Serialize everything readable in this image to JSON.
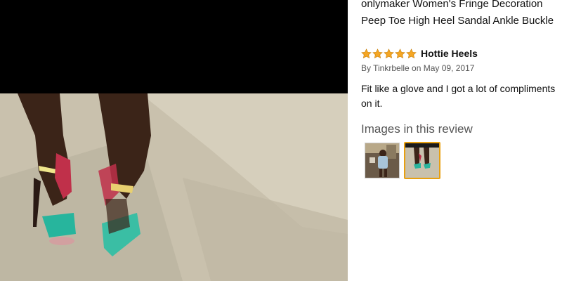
{
  "product": {
    "title": "onlymaker Women's Fringe Decoration Peep Toe High Heel Sandal Ankle Buckle"
  },
  "review": {
    "rating": 5,
    "rating_max": 5,
    "title": "Hottie Heels",
    "byline_prefix": "By ",
    "author": "Tinkrbelle",
    "date_text": " on May 09, 2017",
    "body": "Fit like a glove and I got a lot of compliments on it."
  },
  "images_section": {
    "heading": "Images in this review",
    "thumbnails": [
      {
        "selected": false
      },
      {
        "selected": true
      }
    ]
  },
  "colors": {
    "star": "#f5a623",
    "selected_border": "#e8a010",
    "heading_gray": "#555555"
  }
}
